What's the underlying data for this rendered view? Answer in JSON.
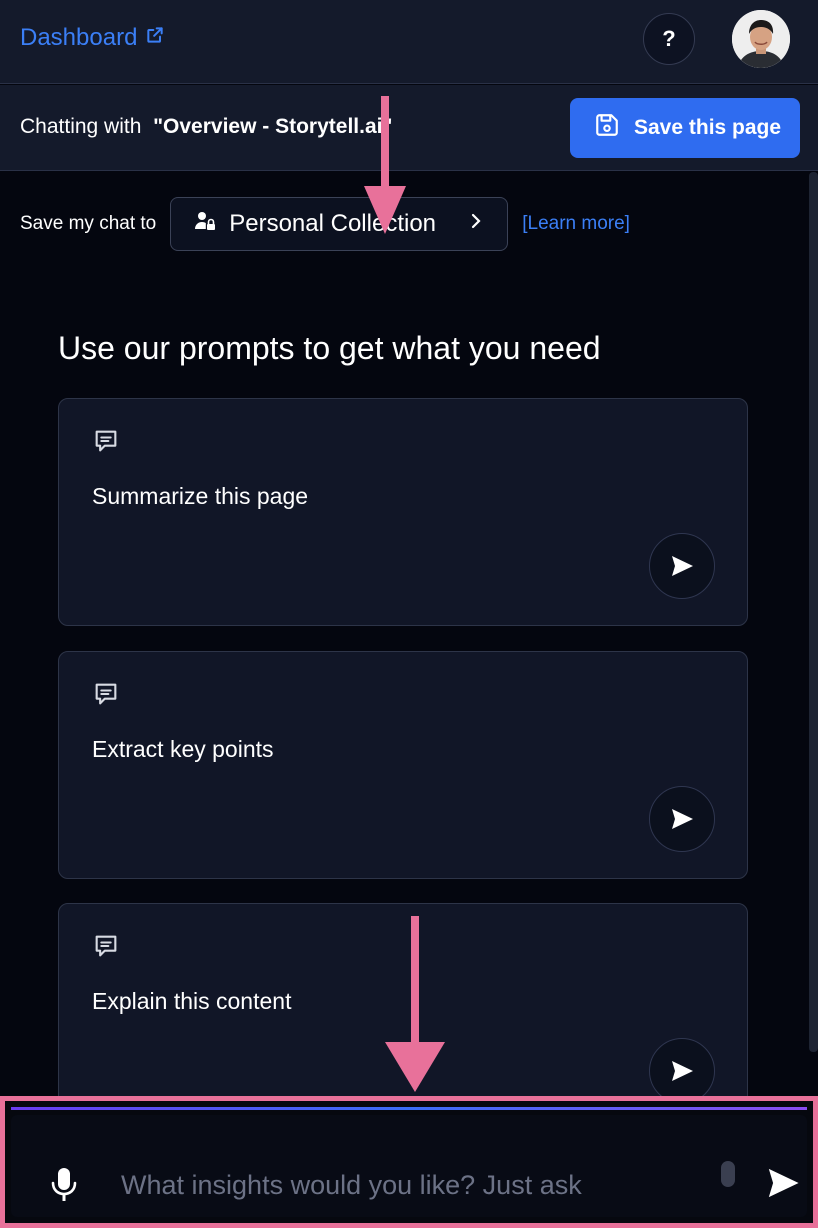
{
  "header": {
    "dashboard_label": "Dashboard",
    "help_label": "?"
  },
  "subheader": {
    "chatting_prefix": "Chatting with  ",
    "page_title": "\"Overview - Storytell.ai\"",
    "save_page_label": "Save this page"
  },
  "save_chat": {
    "label": "Save my chat to",
    "collection_label": "Personal Collection",
    "learn_more": "[Learn more]"
  },
  "prompts": {
    "heading": "Use our prompts to get what you need",
    "items": [
      {
        "label": "Summarize this page"
      },
      {
        "label": "Extract key points"
      },
      {
        "label": "Explain this content"
      }
    ]
  },
  "chat_input": {
    "placeholder": "What insights would you like? Just ask"
  },
  "colors": {
    "accent": "#2f6cf0",
    "link": "#3b7ff6",
    "highlight": "#e8719a",
    "background": "#04060f"
  },
  "icons": [
    "external-link-icon",
    "user-lock-icon",
    "chevron-right-icon",
    "save-icon",
    "chat-bubble-icon",
    "send-icon",
    "microphone-icon"
  ]
}
